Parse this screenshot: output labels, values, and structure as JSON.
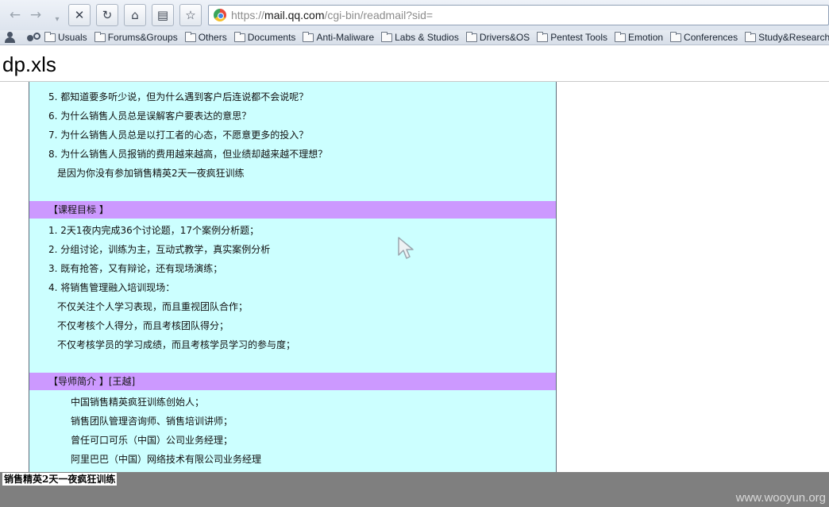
{
  "browser": {
    "url": {
      "scheme": "https://",
      "host": "mail.qq.com",
      "path": "/cgi-bin/readmail?sid="
    },
    "bookmarks": [
      "Usuals",
      "Forums&Groups",
      "Others",
      "Documents",
      "Anti-Maliware",
      "Labs & Studios",
      "Drivers&OS",
      "Pentest Tools",
      "Emotion",
      "Conferences",
      "Study&Research"
    ]
  },
  "page": {
    "title": "dp.xls"
  },
  "document": {
    "top_lines": [
      "5. 都知道要多听少说，但为什么遇到客户后连说都不会说呢？",
      "6. 为什么销售人员总是误解客户要表达的意思？",
      "7. 为什么销售人员总是以打工者的心态，不愿意更多的投入？",
      "8. 为什么销售人员报销的费用越来越高，但业绩却越来越不理想？",
      "是因为你没有参加销售精英2天一夜疯狂训练"
    ],
    "goals_heading": "【课程目标 】",
    "goals_lines": [
      "1. 2天1夜内完成36个讨论题，17个案例分析题；",
      "2. 分组讨论，训练为主，互动式教学，真实案例分析",
      "3. 既有抢答，又有辩论，还有现场演练；",
      "4. 将销售管理融入培训现场：",
      "不仅关注个人学习表现，而且重视团队合作；",
      "不仅考核个人得分，而且考核团队得分；",
      "不仅考核学员的学习成绩，而且考核学员学习的参与度；"
    ],
    "mentor_heading": "【导师简介 】[王越]",
    "mentor_lines": [
      "中国销售精英疯狂训练创始人；",
      "销售团队管理咨询师、销售培训讲师；",
      "曾任可口可乐（中国）公司业务经理；",
      "阿里巴巴（中国）网络技术有限公司业务经理"
    ]
  },
  "sheet_tab": "销售精英2天一夜疯狂训练",
  "watermark": "www.wooyun.org",
  "colors": {
    "doc_background": "#ccffff",
    "band_background": "#cc99ff",
    "sheet_bar": "#7f7f7f"
  }
}
